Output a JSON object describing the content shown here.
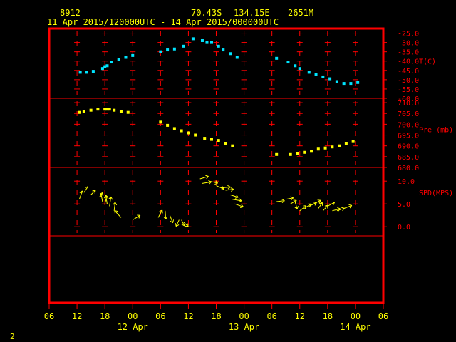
{
  "header": {
    "station": "8912",
    "lat": "70.43S",
    "lon": "134.15E",
    "elev": "2651M",
    "period": "11 Apr 2015/120000UTC - 14 Apr 2015/000000UTC"
  },
  "footer": {
    "page_number": "2"
  },
  "colors": {
    "frame": "#ff0000",
    "temp": "#00e5ff",
    "pres": "#ffff00",
    "wind": "#ffff00",
    "axis_text": "#ffff00"
  },
  "chart_data": {
    "type": "scatter",
    "x_axis": {
      "unit": "hours since 11 Apr 2015 00 UTC",
      "range": [
        6,
        78
      ],
      "ticks": [
        6,
        12,
        18,
        24,
        30,
        36,
        42,
        48,
        54,
        60,
        66,
        72,
        78
      ],
      "tick_labels": [
        "06",
        "12",
        "18",
        "00",
        "06",
        "12",
        "18",
        "00",
        "06",
        "12",
        "18",
        "00",
        "06"
      ],
      "day_labels": [
        {
          "x": 24,
          "label": "12 Apr"
        },
        {
          "x": 48,
          "label": "13 Apr"
        },
        {
          "x": 72,
          "label": "14 Apr"
        }
      ]
    },
    "panels": [
      {
        "name": "T(C)",
        "ylabel": "T(C)",
        "ylim": [
          -60,
          -22.5
        ],
        "ticks": [
          -25,
          -30,
          -35,
          -40,
          -45,
          -50,
          -55,
          -60
        ],
        "tick_labels": [
          "-25.0",
          "-30.0",
          "-35.0",
          "-40.0",
          "-45.0",
          "-50.0",
          "-55.0",
          "-60.0"
        ],
        "points": [
          [
            12.7,
            -46
          ],
          [
            14,
            -46
          ],
          [
            15.5,
            -45.5
          ],
          [
            17.5,
            -44
          ],
          [
            18,
            -43
          ],
          [
            18.5,
            -42.5
          ],
          [
            19.5,
            -40.5
          ],
          [
            21,
            -39
          ],
          [
            22.5,
            -38
          ],
          [
            24,
            -37
          ],
          [
            30,
            -35
          ],
          [
            31.5,
            -34
          ],
          [
            33,
            -33.5
          ],
          [
            35,
            -32
          ],
          [
            37,
            -28
          ],
          [
            39,
            -29
          ],
          [
            40,
            -30
          ],
          [
            41,
            -30
          ],
          [
            42.5,
            -32
          ],
          [
            43.5,
            -34
          ],
          [
            45,
            -36
          ],
          [
            46.5,
            -38
          ],
          [
            55,
            -38.5
          ],
          [
            57.5,
            -40.5
          ],
          [
            59,
            -42.5
          ],
          [
            60,
            -44
          ],
          [
            62,
            -46
          ],
          [
            63.5,
            -47
          ],
          [
            65,
            -48.5
          ],
          [
            66.5,
            -49.5
          ],
          [
            68,
            -51
          ],
          [
            69.5,
            -52
          ],
          [
            71,
            -52
          ],
          [
            72.5,
            -51.5
          ]
        ]
      },
      {
        "name": "Pre (mb)",
        "ylabel": "Pre (mb)",
        "ylim": [
          680,
          712
        ],
        "ticks": [
          680,
          685,
          690,
          695,
          700,
          705,
          710
        ],
        "tick_labels": [
          "680.0",
          "685.0",
          "690.0",
          "695.0",
          "700.0",
          "705.0",
          "710.0"
        ],
        "points": [
          [
            12.5,
            705.5
          ],
          [
            13.5,
            706
          ],
          [
            15,
            706.5
          ],
          [
            16.5,
            707
          ],
          [
            18,
            707
          ],
          [
            18.5,
            707
          ],
          [
            19,
            707
          ],
          [
            20,
            706.5
          ],
          [
            21.5,
            706
          ],
          [
            23,
            705.5
          ],
          [
            30,
            701
          ],
          [
            31.5,
            699.5
          ],
          [
            33,
            698
          ],
          [
            34.5,
            697
          ],
          [
            36,
            696
          ],
          [
            37.5,
            695
          ],
          [
            39.5,
            693.5
          ],
          [
            41,
            693
          ],
          [
            42.5,
            692.5
          ],
          [
            44,
            691
          ],
          [
            45.5,
            690
          ],
          [
            55,
            686
          ],
          [
            58,
            686
          ],
          [
            59.5,
            686.5
          ],
          [
            61,
            687
          ],
          [
            62.5,
            687.5
          ],
          [
            64,
            688.5
          ],
          [
            65.5,
            689
          ],
          [
            67,
            689.5
          ],
          [
            68.5,
            690
          ],
          [
            70,
            691
          ],
          [
            71.5,
            692
          ]
        ]
      },
      {
        "name": "SPD(MPS)",
        "ylabel": "SPD(MPS)",
        "ylim": [
          -2,
          13
        ],
        "ticks": [
          0,
          5,
          10
        ],
        "tick_labels": [
          "0.0",
          "5.0",
          "10.0"
        ],
        "vectors": [
          [
            12.5,
            6,
            0.6,
            1.7
          ],
          [
            13.5,
            7.5,
            0.8,
            1.2
          ],
          [
            15,
            7,
            0.9,
            0.9
          ],
          [
            17,
            6.5,
            0.5,
            0.9
          ],
          [
            17.5,
            5.5,
            -0.3,
            1.6
          ],
          [
            18,
            5,
            0.4,
            1.6
          ],
          [
            18.5,
            5,
            -0.3,
            1.8
          ],
          [
            19,
            4.5,
            0.3,
            1.9
          ],
          [
            20,
            3.5,
            0.2,
            1.7
          ],
          [
            21.5,
            2,
            -1.3,
            1.4
          ],
          [
            24,
            1.5,
            1.5,
            0.9
          ],
          [
            29.5,
            2,
            0.8,
            1.5
          ],
          [
            31,
            3.5,
            0.1,
            -1.7
          ],
          [
            32,
            2.5,
            0.6,
            -1.5
          ],
          [
            34,
            1.5,
            -0.6,
            -1.3
          ],
          [
            34.5,
            1.5,
            0.6,
            -1.2
          ],
          [
            35,
            1,
            0.9,
            -0.9
          ],
          [
            38.5,
            10.5,
            1.7,
            0.5
          ],
          [
            39,
            9.5,
            1.8,
            0.3
          ],
          [
            40.5,
            10,
            1.7,
            -0.4
          ],
          [
            42,
            9,
            1.6,
            -0.7
          ],
          [
            43,
            8.5,
            1.9,
            0.2
          ],
          [
            44,
            8,
            1.6,
            0.2
          ],
          [
            45,
            7,
            1.6,
            -0.5
          ],
          [
            45.5,
            6,
            1.8,
            -0.3
          ],
          [
            46,
            5,
            1.7,
            -0.6
          ],
          [
            55,
            5.5,
            1.6,
            0.2
          ],
          [
            57,
            6,
            1.5,
            0.3
          ],
          [
            58,
            5,
            1.2,
            0.7
          ],
          [
            59,
            5.5,
            0.4,
            -1.5
          ],
          [
            60,
            3.5,
            1.3,
            1
          ],
          [
            61,
            4,
            1.3,
            0.9
          ],
          [
            62,
            4.5,
            1.5,
            0.7
          ],
          [
            63,
            5,
            1.4,
            0.7
          ],
          [
            64,
            4,
            0.8,
            1.2
          ],
          [
            65,
            3.5,
            1,
            1.1
          ],
          [
            66,
            4.5,
            1.4,
            0.8
          ],
          [
            67,
            3.5,
            1.6,
            0.4
          ],
          [
            68,
            3.5,
            1.5,
            0.5
          ],
          [
            69.5,
            4,
            1.6,
            0.6
          ]
        ]
      }
    ]
  }
}
